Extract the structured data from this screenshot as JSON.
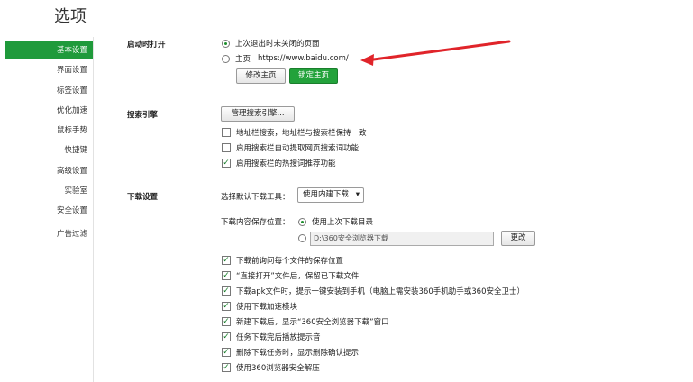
{
  "title": "选项",
  "sidebar": {
    "items": [
      {
        "label": "基本设置",
        "active": true
      },
      {
        "label": "界面设置"
      },
      {
        "label": "标签设置"
      },
      {
        "label": "优化加速"
      },
      {
        "label": "鼠标手势"
      },
      {
        "label": "快捷键"
      },
      {
        "label": "高级设置"
      },
      {
        "label": "实验室"
      },
      {
        "label": "安全设置"
      },
      {
        "label": "广告过滤"
      }
    ]
  },
  "startup": {
    "label": "启动时打开",
    "option_last": "上次退出时未关闭的页面",
    "option_home": "主页",
    "home_url": "https://www.baidu.com/",
    "modify_button": "修改主页",
    "lock_button": "锁定主页"
  },
  "search": {
    "label": "搜索引擎",
    "manage_button": "管理搜索引擎...",
    "options": [
      {
        "label": "地址栏搜索，地址栏与搜索栏保持一致",
        "checked": false
      },
      {
        "label": "启用搜索栏自动提取网页搜索词功能",
        "checked": false
      },
      {
        "label": "启用搜索栏的热搜词推荐功能",
        "checked": true
      }
    ]
  },
  "download": {
    "label": "下载设置",
    "tool_label": "选择默认下载工具：",
    "tool_value": "使用内建下载",
    "save_label": "下载内容保存位置：",
    "save_last": "使用上次下载目录",
    "save_path": "D:\\360安全浏览器下载",
    "change_button": "更改",
    "options": [
      {
        "label": "下载前询问每个文件的保存位置",
        "checked": true
      },
      {
        "label": "“直接打开”文件后，保留已下载文件",
        "checked": true
      },
      {
        "label": "下载apk文件时，提示一键安装到手机（电脑上需安装360手机助手或360安全卫士）",
        "checked": true
      },
      {
        "label": "使用下载加速模块",
        "checked": true
      },
      {
        "label": "新建下载后，显示“360安全浏览器下载”窗口",
        "checked": true
      },
      {
        "label": "任务下载完后播放提示音",
        "checked": true
      },
      {
        "label": "删除下载任务时，显示删除确认提示",
        "checked": true
      },
      {
        "label": "使用360浏览器安全解压",
        "checked": true
      }
    ]
  },
  "colors": {
    "accent": "#1f9a3b",
    "arrow": "#e0242a"
  }
}
